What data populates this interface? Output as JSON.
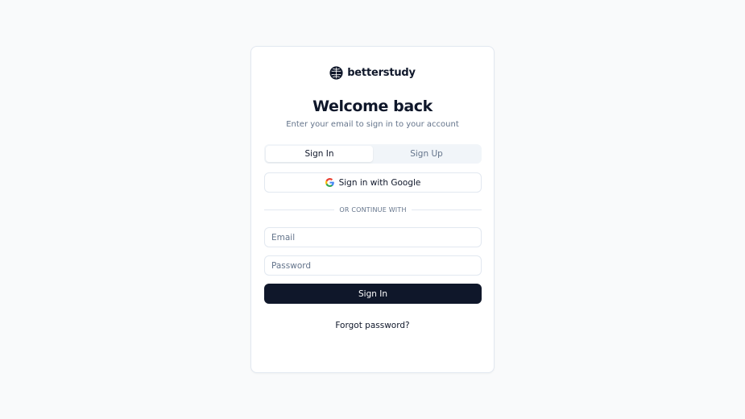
{
  "brand": {
    "name": "betterstudy",
    "logo_icon": "brain-icon"
  },
  "header": {
    "title": "Welcome back",
    "subtitle": "Enter your email to sign in to your account"
  },
  "tabs": [
    {
      "label": "Sign In",
      "active": true
    },
    {
      "label": "Sign Up",
      "active": false
    }
  ],
  "google_button": {
    "label": "Sign in with Google",
    "icon": "google-icon"
  },
  "divider": {
    "text": "Or continue with"
  },
  "form": {
    "email": {
      "placeholder": "Email",
      "value": ""
    },
    "password": {
      "placeholder": "Password",
      "value": ""
    },
    "submit_label": "Sign In"
  },
  "forgot_password": "Forgot password?",
  "colors": {
    "primary": "#0f172a",
    "muted_text": "#64748b",
    "border": "#e2e8f0",
    "background": "#f9fafb"
  }
}
